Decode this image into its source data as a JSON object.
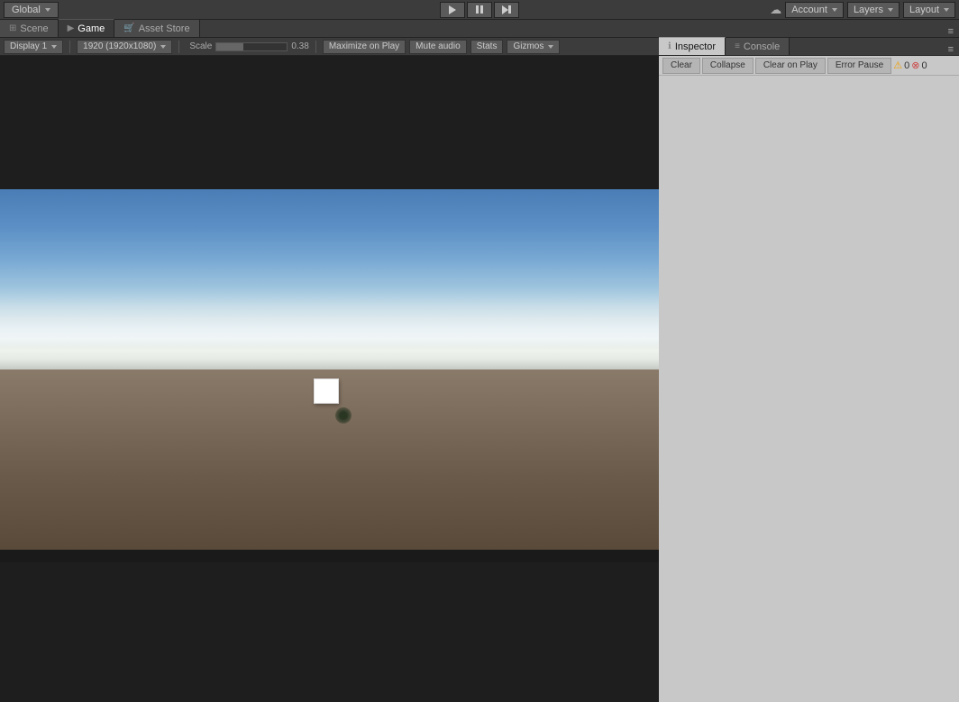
{
  "topbar": {
    "global_label": "Global",
    "account_label": "Account",
    "layers_label": "Layers",
    "layout_label": "Layout"
  },
  "tabs": {
    "scene_label": "Scene",
    "game_label": "Game",
    "asset_store_label": "Asset Store"
  },
  "game_toolbar": {
    "display_label": "Display 1",
    "resolution_label": "1920 (1920x1080)",
    "scale_label": "Scale",
    "scale_value": "0.38",
    "maximize_label": "Maximize on Play",
    "mute_label": "Mute audio",
    "stats_label": "Stats",
    "gizmos_label": "Gizmos"
  },
  "right_tabs": {
    "inspector_label": "Inspector",
    "console_label": "Console"
  },
  "right_toolbar": {
    "clear_label": "Clear",
    "collapse_label": "Collapse",
    "clear_on_play_label": "Clear on Play",
    "error_pause_label": "Error Pause",
    "warning_count": "0",
    "error_count": "0"
  }
}
